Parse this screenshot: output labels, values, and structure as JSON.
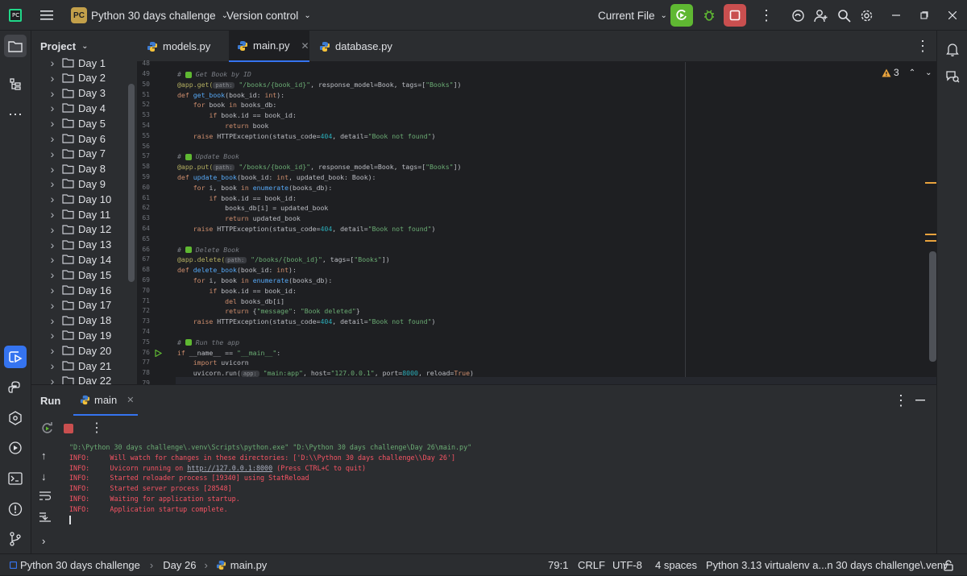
{
  "header": {
    "project_badge": "PC",
    "project_name": "Python 30 days challenge",
    "vcs": "Version control",
    "run_config": "Current File"
  },
  "project_panel": {
    "title": "Project",
    "items": [
      "Day 1",
      "Day 2",
      "Day 3",
      "Day 4",
      "Day 5",
      "Day 6",
      "Day 7",
      "Day 8",
      "Day 9",
      "Day 10",
      "Day 11",
      "Day 12",
      "Day 13",
      "Day 14",
      "Day 15",
      "Day 16",
      "Day 17",
      "Day 18",
      "Day 19",
      "Day 20",
      "Day 21",
      "Day 22"
    ]
  },
  "editor": {
    "tabs": [
      {
        "label": "models.py",
        "active": false
      },
      {
        "label": "main.py",
        "active": true
      },
      {
        "label": "database.py",
        "active": false
      }
    ],
    "warnings_count": "3",
    "line_numbers": [
      "48",
      "49",
      "50",
      "51",
      "52",
      "53",
      "54",
      "55",
      "56",
      "57",
      "58",
      "59",
      "60",
      "61",
      "62",
      "63",
      "64",
      "65",
      "66",
      "67",
      "68",
      "69",
      "70",
      "71",
      "72",
      "73",
      "74",
      "75",
      "76",
      "77",
      "78",
      "79"
    ]
  },
  "run_panel": {
    "title": "Run",
    "tab": "main",
    "console": [
      {
        "text": "\"D:\\Python 30 days challenge\\.venv\\Scripts\\python.exe\" \"D:\\Python 30 days challenge\\Day 26\\main.py\"",
        "kind": "cmd"
      },
      {
        "text": "INFO:     Will watch for changes in these directories: ['D:\\\\Python 30 days challenge\\\\Day 26']",
        "kind": "log"
      },
      {
        "text": "INFO:     Uvicorn running on ",
        "link": "http://127.0.0.1:8000",
        "suffix": " (Press CTRL+C to quit)",
        "kind": "log"
      },
      {
        "text": "INFO:     Started reloader process [19340] using StatReload",
        "kind": "log"
      },
      {
        "text": "INFO:     Started server process [28548]",
        "kind": "log"
      },
      {
        "text": "INFO:     Waiting for application startup.",
        "kind": "log"
      },
      {
        "text": "INFO:     Application startup complete.",
        "kind": "log"
      }
    ]
  },
  "statusbar": {
    "project": "Python 30 days challenge",
    "folder": "Day 26",
    "file": "main.py",
    "position": "79:1",
    "line_sep": "CRLF",
    "encoding": "UTF-8",
    "indent": "4 spaces",
    "interpreter": "Python 3.13 virtualenv a...n 30 days challenge\\.venv"
  },
  "colors": {
    "accent": "#3574f0",
    "run_green": "#5fb832",
    "stop_red": "#c94f4f",
    "log_red": "#f75464"
  }
}
